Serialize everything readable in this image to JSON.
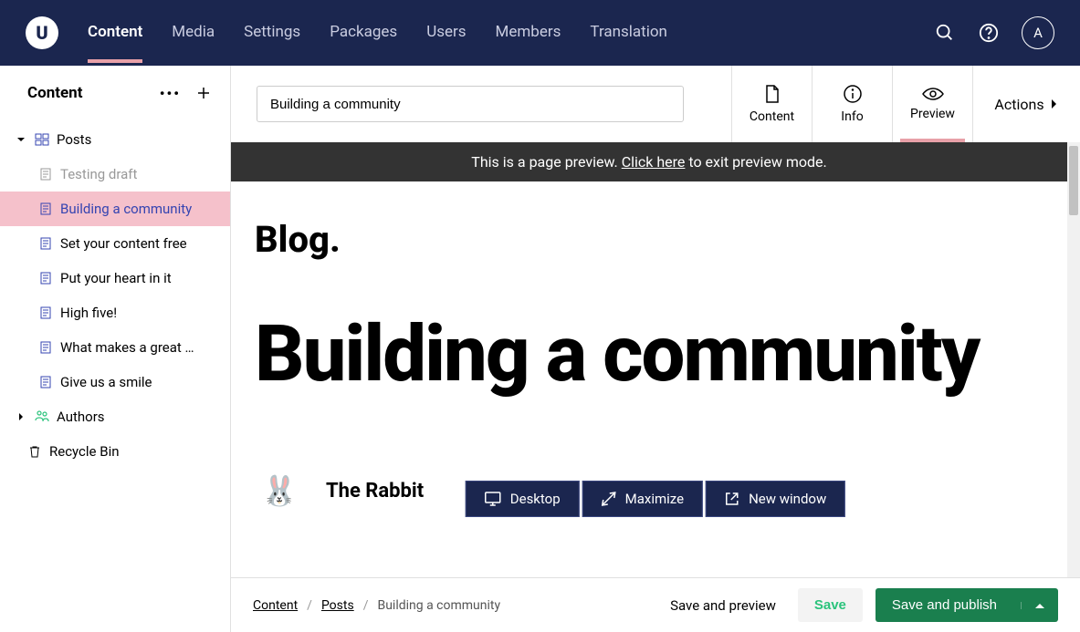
{
  "topnav": {
    "logo_letter": "U",
    "items": [
      "Content",
      "Media",
      "Settings",
      "Packages",
      "Users",
      "Members",
      "Translation"
    ],
    "avatar_letter": "A"
  },
  "sidebar": {
    "title": "Content",
    "groups": [
      {
        "label": "Posts",
        "expanded": true
      },
      {
        "label": "Authors",
        "expanded": false
      }
    ],
    "posts": [
      {
        "label": "Testing draft",
        "muted": true
      },
      {
        "label": "Building a community",
        "selected": true
      },
      {
        "label": "Set your content free"
      },
      {
        "label": "Put your heart in it"
      },
      {
        "label": "High five!"
      },
      {
        "label": "What makes a great …"
      },
      {
        "label": "Give us a smile"
      }
    ],
    "recycle": "Recycle Bin"
  },
  "header": {
    "title_value": "Building a community",
    "tabs": {
      "content": "Content",
      "info": "Info",
      "preview": "Preview",
      "actions": "Actions"
    }
  },
  "preview": {
    "banner_text": "This is a page preview. ",
    "banner_link": "Click here",
    "banner_suffix": " to exit preview mode.",
    "blog_label": "Blog.",
    "title": "Building a community",
    "author": "The Rabbit",
    "author_emoji": "🐰",
    "device_buttons": {
      "desktop": "Desktop",
      "maximize": "Maximize",
      "new_window": "New window"
    }
  },
  "footer": {
    "breadcrumb": [
      "Content",
      "Posts",
      "Building a community"
    ],
    "save_preview": "Save and preview",
    "save": "Save",
    "save_publish": "Save and publish"
  }
}
